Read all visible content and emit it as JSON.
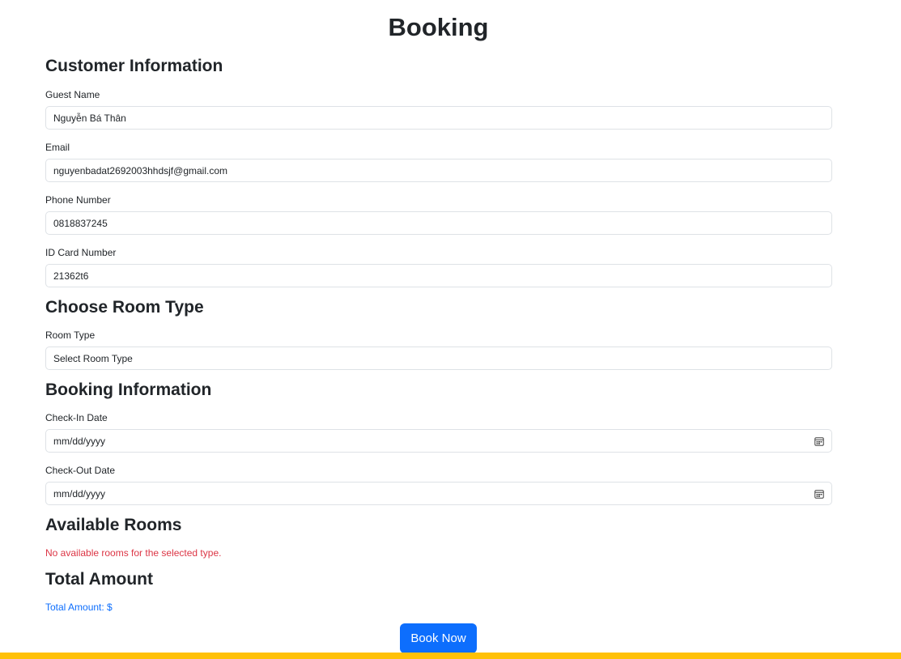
{
  "page": {
    "title": "Booking"
  },
  "customer": {
    "heading": "Customer Information",
    "guest_name": {
      "label": "Guest Name",
      "value": "Nguyễn Bá Thân"
    },
    "email": {
      "label": "Email",
      "value": "nguyenbadat2692003hhdsjf@gmail.com"
    },
    "phone": {
      "label": "Phone Number",
      "value": "0818837245"
    },
    "id_card": {
      "label": "ID Card Number",
      "value": "21362t6"
    }
  },
  "room": {
    "heading": "Choose Room Type",
    "label": "Room Type",
    "selected": "Select Room Type"
  },
  "booking": {
    "heading": "Booking Information",
    "check_in": {
      "label": "Check-In Date",
      "placeholder": "mm/dd/yyyy"
    },
    "check_out": {
      "label": "Check-Out Date",
      "placeholder": "mm/dd/yyyy"
    }
  },
  "available": {
    "heading": "Available Rooms",
    "message": "No available rooms for the selected type."
  },
  "total": {
    "heading": "Total Amount",
    "text": "Total Amount: $"
  },
  "actions": {
    "book_label": "Book Now"
  },
  "colors": {
    "primary": "#0d6efd",
    "danger": "#dc3545",
    "footer_bar": "#ffc107",
    "border": "#dee2e6"
  },
  "icons": {
    "date_picker": "calendar-icon"
  }
}
